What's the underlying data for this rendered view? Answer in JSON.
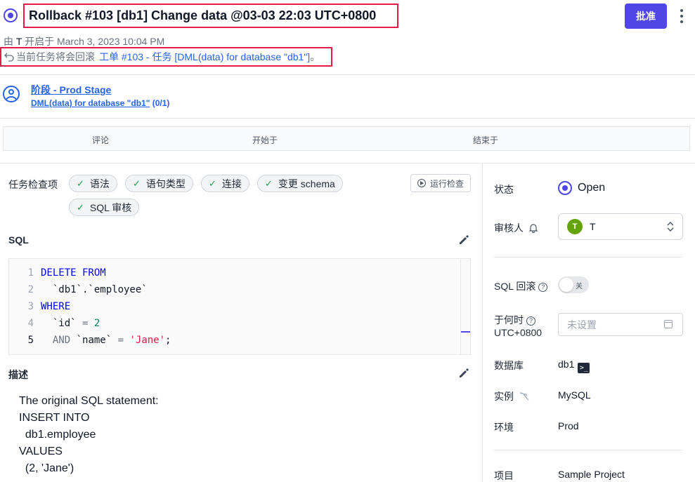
{
  "header": {
    "title": "Rollback #103 [db1] Change data @03-03 22:03 UTC+0800",
    "approve_label": "批准",
    "opened_prefix": "由",
    "opened_by": "T",
    "opened_suffix": "开启于 March 3, 2023 10:04 PM",
    "rollback_text": "当前任务将会回滚",
    "rollback_link": "工单 #103 - 任务 [DML(data) for database \"db1\"]",
    "rollback_end": "。"
  },
  "stage": {
    "name": "阶段 - Prod Stage",
    "task_name": "DML(data) for database \"db1\"",
    "task_count": "(0/1)"
  },
  "table_header": {
    "col_comment": "评论",
    "col_started": "开始于",
    "col_ended": "结束于"
  },
  "checks": {
    "label": "任务检查项",
    "items": [
      "语法",
      "语句类型",
      "连接",
      "变更 schema",
      "SQL 审核"
    ],
    "run_label": "运行检查"
  },
  "sql": {
    "label": "SQL",
    "line_numbers": [
      "1",
      "2",
      "3",
      "4",
      "5"
    ],
    "kw_delete_from": "DELETE FROM",
    "table": "  `db1`.`employee`",
    "kw_where": "WHERE",
    "col_id": "  `id`",
    "eq": " = ",
    "num_2": "2",
    "kw_and": "  AND",
    "col_name": " `name`",
    "str_jane": "'Jane'",
    "semi": ";"
  },
  "description": {
    "label": "描述",
    "text": "The original SQL statement:\nINSERT INTO\n  db1.employee\nVALUES\n  (2, 'Jane')"
  },
  "sidebar": {
    "status_label": "状态",
    "status_value": "Open",
    "reviewer_label": "审核人",
    "reviewer_initial": "T",
    "reviewer_name": "T",
    "rollback_label": "SQL 回滚",
    "rollback_toggle": "关",
    "when_label": "于何时",
    "when_tz": "UTC+0800",
    "when_placeholder": "未设置",
    "database_label": "数据库",
    "database_value": "db1",
    "instance_label": "实例",
    "instance_value": "MySQL",
    "env_label": "环境",
    "env_value": "Prod",
    "project_label": "项目",
    "project_value": "Sample Project"
  },
  "colors": {
    "accent": "#4f46e5",
    "link": "#2563eb",
    "highlight_border": "#e11d48",
    "check_green": "#16a34a",
    "avatar_green": "#65a30d"
  }
}
